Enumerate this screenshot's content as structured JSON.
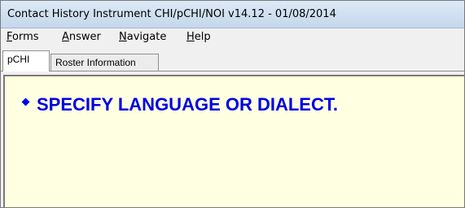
{
  "window": {
    "title": "Contact History Instrument CHI/pCHI/NOI v14.12 - 01/08/2014"
  },
  "menu": [
    {
      "mnemonic": "F",
      "rest": "orms"
    },
    {
      "mnemonic": "A",
      "rest": "nswer"
    },
    {
      "mnemonic": "N",
      "rest": "avigate"
    },
    {
      "mnemonic": "H",
      "rest": "elp"
    }
  ],
  "tabs": [
    {
      "label": "pCHI",
      "active": true
    },
    {
      "label": "Roster Information",
      "active": false
    }
  ],
  "content": {
    "background_color": "#ffffe1",
    "text_color": "#0000e6",
    "bullet_icon": "diamond-bullet-icon",
    "question": "SPECIFY LANGUAGE OR DIALECT."
  }
}
